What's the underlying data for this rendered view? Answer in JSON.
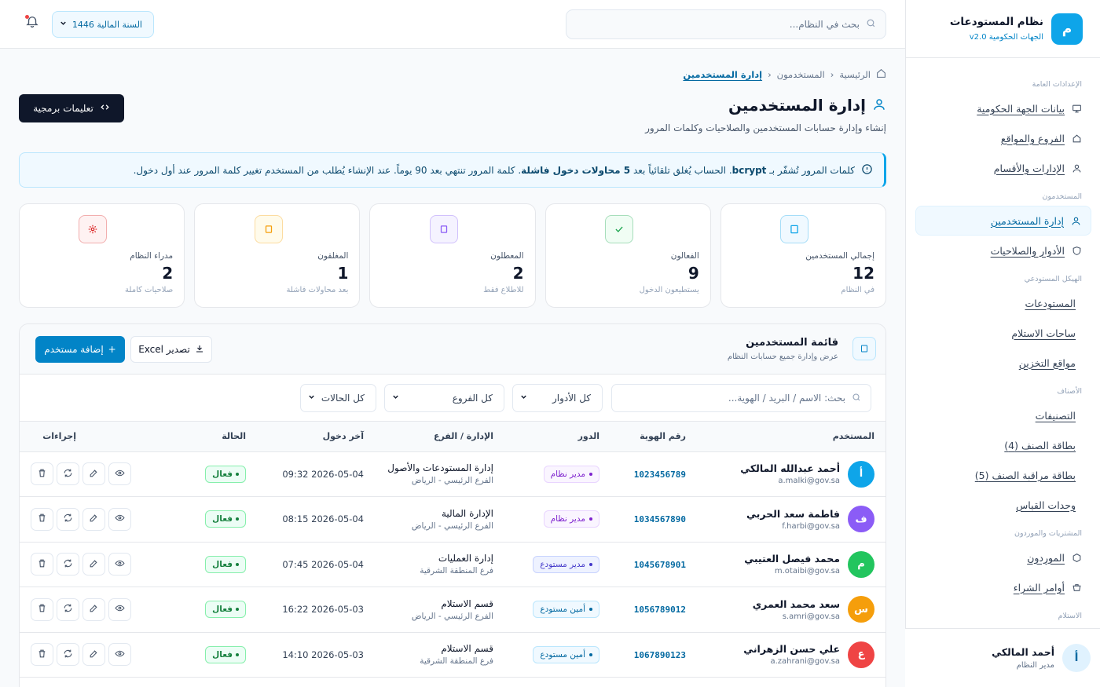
{
  "sidebar": {
    "brand_letter": "م",
    "brand_title": "نظام المستودعات",
    "brand_sub": "الجهات الحكومية v2.0",
    "sections": [
      {
        "title": "الإعدادات العامة",
        "items": [
          {
            "label": "بيانات الجهة الحكومية",
            "icon": "monitor-icon"
          },
          {
            "label": "الفروع والمواقع",
            "icon": "home-icon"
          },
          {
            "label": "الإدارات والأقسام",
            "icon": "user-icon"
          }
        ]
      },
      {
        "title": "المستخدمون",
        "items": [
          {
            "label": "إدارة المستخدمين",
            "icon": "user-icon",
            "active": true
          },
          {
            "label": "الأدوار والصلاحيات",
            "icon": "shield-icon"
          }
        ]
      },
      {
        "title": "الهيكل المستودعي",
        "items": [
          {
            "label": "المستودعات"
          },
          {
            "label": "ساحات الاستلام"
          },
          {
            "label": "مواقع التخزين"
          }
        ]
      },
      {
        "title": "الأصناف",
        "items": [
          {
            "label": "التصنيفات"
          },
          {
            "label": "بطاقة الصنف (4)"
          },
          {
            "label": "بطاقة مراقبة الصنف (5)"
          },
          {
            "label": "وحدات القياس"
          }
        ]
      },
      {
        "title": "المشتريات والموردون",
        "items": [
          {
            "label": "الموردون",
            "icon": "hexagon-icon"
          },
          {
            "label": "أوامر الشراء",
            "icon": "cart-icon"
          }
        ]
      },
      {
        "title": "الاستلام",
        "items": []
      }
    ],
    "user": {
      "initial": "أ",
      "name": "أحمد المالكي",
      "role": "مدير النظام"
    }
  },
  "topbar": {
    "search_placeholder": "بحث في النظام...",
    "fiscal_year": "السنة المالية 1446"
  },
  "breadcrumb": {
    "home": "الرئيسية",
    "parent": "المستخدمون",
    "current": "إدارة المستخدمين"
  },
  "page": {
    "title": "إدارة المستخدمين",
    "subtitle": "إنشاء وإدارة حسابات المستخدمين والصلاحيات وكلمات المرور",
    "dev_button": "تعليمات برمجية"
  },
  "alert": {
    "t1": "كلمات المرور تُشفّر بـ ",
    "b1": "bcrypt",
    "t2": ". الحساب يُغلق تلقائياً بعد ",
    "b2": "5 محاولات دخول فاشلة",
    "t3": ". كلمة المرور تنتهي بعد 90 يوماً. عند الإنشاء يُطلب من المستخدم تغيير كلمة المرور عند أول دخول."
  },
  "stats": [
    {
      "label": "إجمالي المستخدمين",
      "value": "12",
      "note": "في النظام",
      "icon": "user-card-icon",
      "color": "#0ea5e9",
      "bg": "#f0f9ff"
    },
    {
      "label": "الفعالون",
      "value": "9",
      "note": "يستطيعون الدخول",
      "icon": "check-icon",
      "color": "#16a34a",
      "bg": "#f0fdf4"
    },
    {
      "label": "المعطلون",
      "value": "2",
      "note": "للاطلاع فقط",
      "icon": "pause-icon",
      "color": "#8b5cf6",
      "bg": "#f5f3ff"
    },
    {
      "label": "المغلقون",
      "value": "1",
      "note": "بعد محاولات فاشلة",
      "icon": "lock-icon",
      "color": "#f59e0b",
      "bg": "#fffbeb"
    },
    {
      "label": "مدراء النظام",
      "value": "2",
      "note": "صلاحيات كاملة",
      "icon": "gear-icon",
      "color": "#dc2626",
      "bg": "#fef2f2"
    }
  ],
  "panel": {
    "title": "قائمة المستخدمين",
    "subtitle": "عرض وإدارة جميع حسابات النظام",
    "add_button": "إضافة مستخدم",
    "export_button": "تصدير Excel",
    "search_placeholder": "بحث: الاسم / البريد / الهوية...",
    "role_filter": "كل الأدوار",
    "branch_filter": "كل الفروع",
    "status_filter": "كل الحالات"
  },
  "table": {
    "headers": [
      "المستخدم",
      "رقم الهوية",
      "الدور",
      "الإدارة / الفرع",
      "آخر دخول",
      "الحالة",
      "إجراءات"
    ],
    "rows": [
      {
        "initial": "أ",
        "color": "#0ea5e9",
        "name": "أحمد عبدالله المالكي",
        "email": "a.malki@gov.sa",
        "id": "1023456789",
        "role": "مدير نظام",
        "role_type": "admin",
        "dept": "إدارة المستودعات والأصول",
        "branch": "الفرع الرئيسي - الرياض",
        "last": "2026-05-04 09:32",
        "status": "فعال"
      },
      {
        "initial": "ف",
        "color": "#8b5cf6",
        "name": "فاطمة سعد الحربي",
        "email": "f.harbi@gov.sa",
        "id": "1034567890",
        "role": "مدير نظام",
        "role_type": "admin",
        "dept": "الإدارة المالية",
        "branch": "الفرع الرئيسي - الرياض",
        "last": "2026-05-04 08:15",
        "status": "فعال"
      },
      {
        "initial": "م",
        "color": "#22c55e",
        "name": "محمد فيصل العتيبي",
        "email": "m.otaibi@gov.sa",
        "id": "1045678901",
        "role": "مدير مستودع",
        "role_type": "mgr",
        "dept": "إدارة العمليات",
        "branch": "فرع المنطقة الشرقية",
        "last": "2026-05-04 07:45",
        "status": "فعال"
      },
      {
        "initial": "س",
        "color": "#f59e0b",
        "name": "سعد محمد العمري",
        "email": "s.amri@gov.sa",
        "id": "1056789012",
        "role": "أمين مستودع",
        "role_type": "keeper",
        "dept": "قسم الاستلام",
        "branch": "الفرع الرئيسي - الرياض",
        "last": "2026-05-03 16:22",
        "status": "فعال"
      },
      {
        "initial": "ع",
        "color": "#ef4444",
        "name": "علي حسن الزهراني",
        "email": "a.zahrani@gov.sa",
        "id": "1067890123",
        "role": "أمين مستودع",
        "role_type": "keeper",
        "dept": "قسم الاستلام",
        "branch": "فرع المنطقة الشرقية",
        "last": "2026-05-03 14:10",
        "status": "فعال"
      }
    ]
  }
}
